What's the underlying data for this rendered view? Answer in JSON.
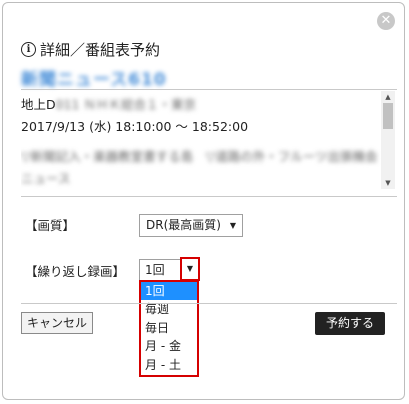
{
  "dialog": {
    "title": "詳細／番組表予約",
    "program_name": "新聞ニュース610",
    "close_glyph": "✕"
  },
  "details": {
    "channel_prefix": "地上D",
    "channel_blurred": "011 ＮＨＫ総合１・東京",
    "datetime": "2017/9/13 (水) 18:10:00 ～ 18:52:00",
    "desc_blurred_1": "▽新聞記入・楽器教室書する島　▽道路の外・フルーツ出張機会たち",
    "desc_blurred_2": "ニュース"
  },
  "form": {
    "quality_label": "【画質】",
    "quality_value": "DR(最高画質)",
    "repeat_label": "【繰り返し録画】",
    "repeat_value": "1回",
    "repeat_options": [
      "1回",
      "毎週",
      "毎日",
      "月 - 金",
      "月 - 土"
    ],
    "repeat_selected_index": 0
  },
  "buttons": {
    "cancel": "キャンセル",
    "reserve": "予約する"
  },
  "colors": {
    "highlight_border": "#d50000",
    "selected_option_bg": "#1e90ff",
    "program_name_color": "#4a90d9"
  }
}
